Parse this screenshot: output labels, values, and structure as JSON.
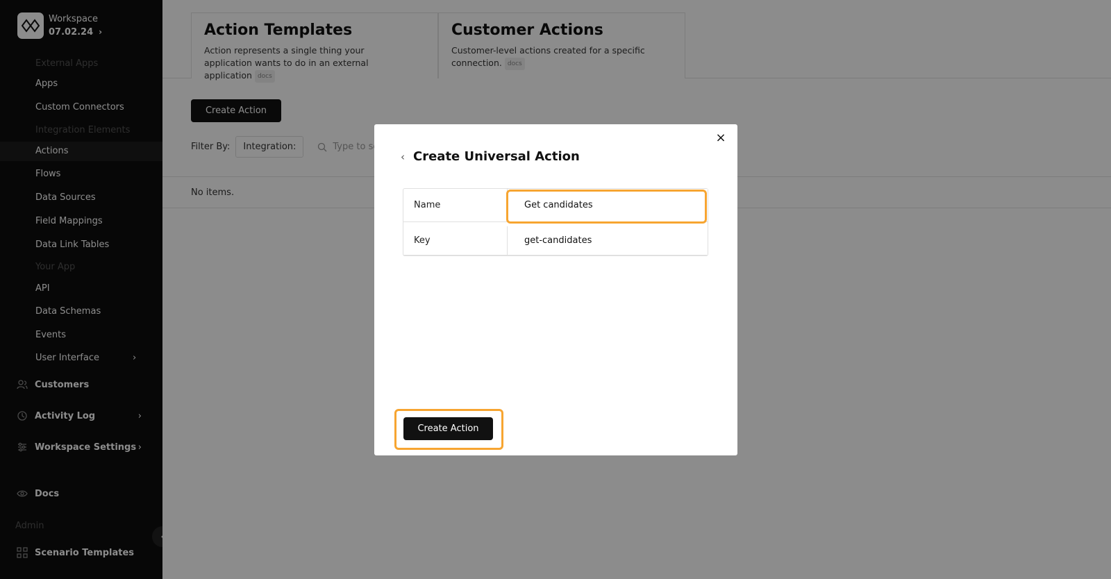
{
  "workspace": {
    "name": "Workspace",
    "version": "07.02.24"
  },
  "sidebar": {
    "sections": [
      "External Apps",
      "Integration Elements",
      "Your App",
      "Admin"
    ],
    "items": [
      "Apps",
      "Custom Connectors",
      "Actions",
      "Flows",
      "Data Sources",
      "Field Mappings",
      "Data Link Tables",
      "API",
      "Data Schemas",
      "Events",
      "User Interface"
    ],
    "main": [
      "Customers",
      "Activity Log",
      "Workspace Settings",
      "Docs",
      "Scenario Templates"
    ]
  },
  "tabs": [
    {
      "title": "Action Templates",
      "desc": "Action represents a single thing your application wants to do in an external application",
      "tag": "docs"
    },
    {
      "title": "Customer Actions",
      "desc": "Customer-level actions created for a specific connection.",
      "tag": "docs"
    }
  ],
  "toolbar": {
    "create_label": "Create Action"
  },
  "filter": {
    "label": "Filter By:",
    "integration": "Integration:",
    "search_placeholder": "Type to se"
  },
  "list": {
    "empty": "No items."
  },
  "modal": {
    "title": "Create Universal Action",
    "fields": [
      {
        "label": "Name",
        "value": "Get candidates"
      },
      {
        "label": "Key",
        "value": "get-candidates"
      }
    ],
    "submit_label": "Create Action",
    "close": "×",
    "back": "‹"
  },
  "colors": {
    "highlight": "#f7a531",
    "primary": "#111111",
    "sidebar_bg": "#0d0d0d"
  }
}
